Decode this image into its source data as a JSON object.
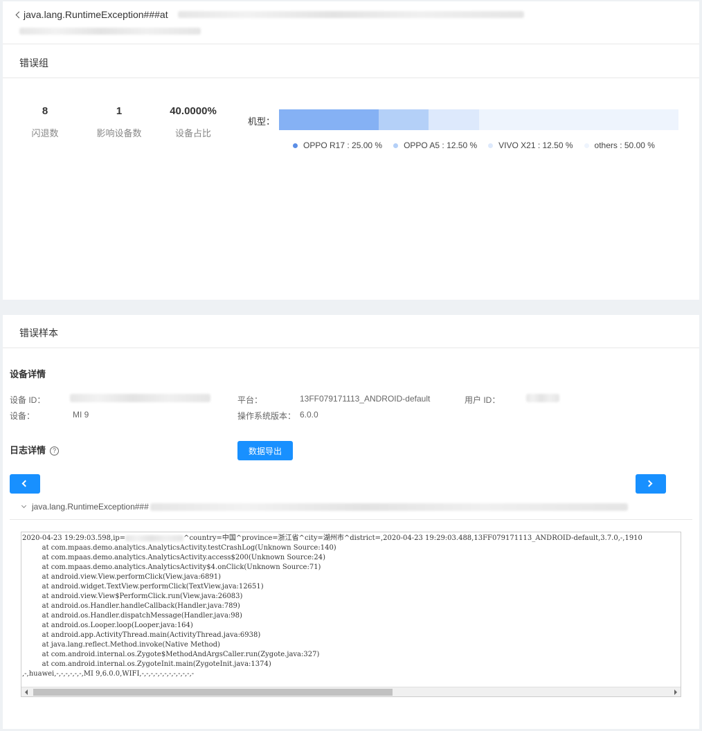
{
  "header": {
    "title": "java.lang.RuntimeException###at"
  },
  "group": {
    "section_title": "错误组",
    "stats": [
      {
        "value": "8",
        "label": "闪退数"
      },
      {
        "value": "1",
        "label": "影响设备数"
      },
      {
        "value": "40.0000%",
        "label": "设备占比"
      }
    ],
    "bar_label": "机型：",
    "segments": [
      {
        "label": "OPPO R17 : 25.00 %",
        "share": 0.25,
        "color": "#85b1f4"
      },
      {
        "label": "OPPO A5 : 12.50 %",
        "share": 0.125,
        "color": "#b4d0f8"
      },
      {
        "label": "VIVO X21 : 12.50 %",
        "share": 0.125,
        "color": "#dde9fc"
      },
      {
        "label": "others : 50.00 %",
        "share": 0.5,
        "color": "#eef4fd"
      }
    ]
  },
  "sample": {
    "section_title": "错误样本",
    "device_title": "设备详情",
    "device_id_key": "设备 ID：",
    "platform_key": "平台：",
    "platform_val": "13FF079171113_ANDROID-default",
    "user_id_key": "用户 ID：",
    "device_key": "设备：",
    "device_val": "MI 9",
    "os_key": "操作系统版本：",
    "os_val": "6.0.0",
    "log_title": "日志详情",
    "help_glyph": "?",
    "export_label": "数据导出",
    "exception_title": "java.lang.RuntimeException###",
    "log_lines": [
      "2020-04-23 19:29:03.598,ip=",
      "^country=中国^province=浙江省^city=湖州市^district=,2020-04-23 19:29:03.488,13FF079171113_ANDROID-default,3.7.0,-,1910",
      "\tat com.mpaas.demo.analytics.AnalyticsActivity.testCrashLog(Unknown Source:140)",
      "\tat com.mpaas.demo.analytics.AnalyticsActivity.access$200(Unknown Source:24)",
      "\tat com.mpaas.demo.analytics.AnalyticsActivity$4.onClick(Unknown Source:71)",
      "\tat android.view.View.performClick(View.java:6891)",
      "\tat android.widget.TextView.performClick(TextView.java:12651)",
      "\tat android.view.View$PerformClick.run(View.java:26083)",
      "\tat android.os.Handler.handleCallback(Handler.java:789)",
      "\tat android.os.Handler.dispatchMessage(Handler.java:98)",
      "\tat android.os.Looper.loop(Looper.java:164)",
      "\tat android.app.ActivityThread.main(ActivityThread.java:6938)",
      "\tat java.lang.reflect.Method.invoke(Native Method)",
      "\tat com.android.internal.os.Zygote$MethodAndArgsCaller.run(Zygote.java:327)",
      "\tat com.android.internal.os.ZygoteInit.main(ZygoteInit.java:1374)",
      ",-,huawei,-,-,-,-,-,-,MI 9,6.0.0,WIFI,-,-,-,-,-,-,-,-,-,-,-,-"
    ]
  }
}
